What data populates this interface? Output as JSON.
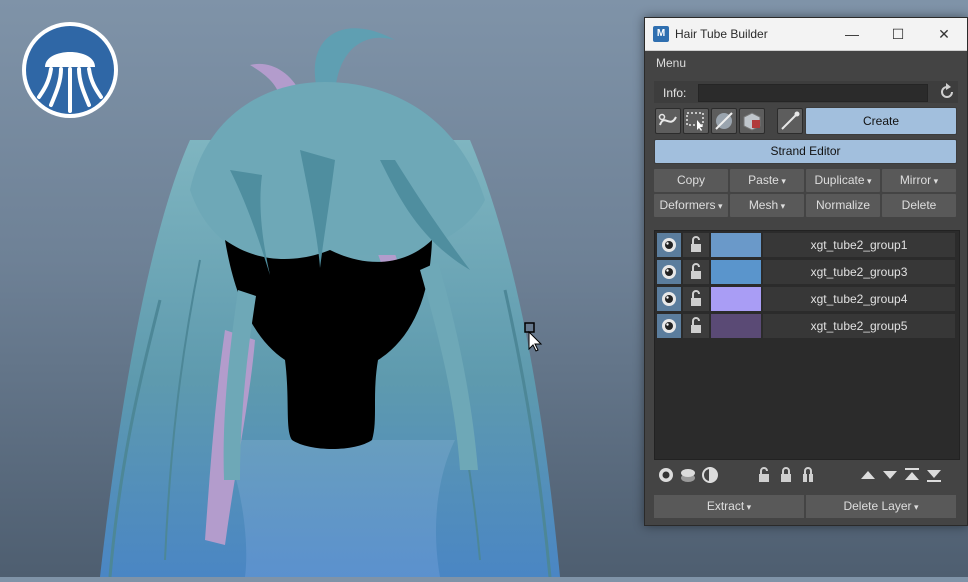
{
  "window": {
    "title": "Hair Tube Builder",
    "app_icon_letter": "M",
    "minimize": "—",
    "maximize": "☐",
    "close": "✕"
  },
  "menu": {
    "label": "Menu"
  },
  "info": {
    "label": "Info:",
    "value": ""
  },
  "buttons": {
    "create": "Create",
    "strand_editor": "Strand Editor",
    "copy": "Copy",
    "paste": "Paste",
    "duplicate": "Duplicate",
    "mirror": "Mirror",
    "deformers": "Deformers",
    "mesh": "Mesh",
    "normalize": "Normalize",
    "delete": "Delete",
    "extract": "Extract",
    "delete_layer": "Delete Layer"
  },
  "layers": [
    {
      "name": "xgt_tube2_group1",
      "color": "#6a99c9"
    },
    {
      "name": "xgt_tube2_group3",
      "color": "#5a95cc"
    },
    {
      "name": "xgt_tube2_group4",
      "color": "#a99df5"
    },
    {
      "name": "xgt_tube2_group5",
      "color": "#5a4a75"
    }
  ],
  "colors": {
    "accent_button": "#a2bfdd",
    "panel_bg": "#444444",
    "hair_teal": "#6fa9b6",
    "hair_lilac": "#b39ccc"
  }
}
